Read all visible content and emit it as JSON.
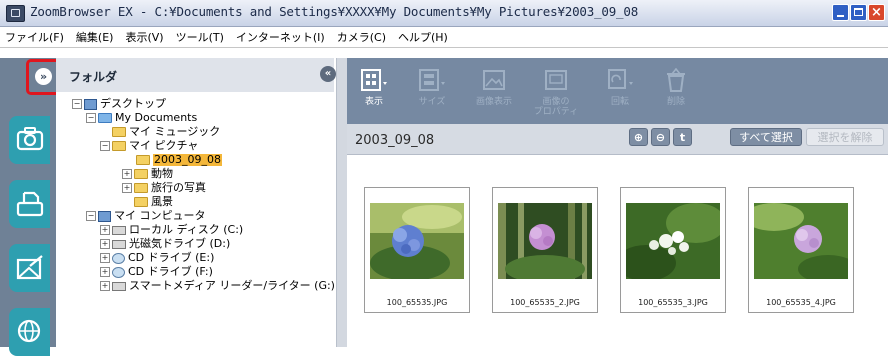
{
  "window": {
    "title": "ZoomBrowser EX  -  C:¥Documents and Settings¥XXXX¥My Documents¥My Pictures¥2003_09_08",
    "controls": [
      "minimize",
      "maximize",
      "close"
    ]
  },
  "menu": {
    "items": [
      "ファイル(F)",
      "編集(E)",
      "表示(V)",
      "ツール(T)",
      "インターネット(I)",
      "カメラ(C)",
      "ヘルプ(H)"
    ]
  },
  "sidebar": {
    "expand_icon": "double-chevron-right-icon",
    "highlight_color": "#e0161e",
    "tabs": [
      "camera-icon",
      "print-icon",
      "email-icon",
      "web-globe-icon"
    ]
  },
  "folder_panel": {
    "title": "フォルダ",
    "collapse_icon": "double-chevron-left-icon",
    "tree": [
      {
        "label": "デスクトップ",
        "icon": "desktop-icon"
      },
      {
        "label": "My Documents",
        "icon": "folder-icon"
      },
      {
        "label": "マイ ミュージック",
        "icon": "folder-icon"
      },
      {
        "label": "マイ ピクチャ",
        "icon": "folder-icon"
      },
      {
        "label": "2003_09_08",
        "icon": "folder-icon",
        "selected": true
      },
      {
        "label": "動物",
        "icon": "folder-icon"
      },
      {
        "label": "旅行の写真",
        "icon": "folder-icon"
      },
      {
        "label": "風景",
        "icon": "folder-icon"
      },
      {
        "label": "マイ コンピュータ",
        "icon": "computer-icon"
      },
      {
        "label": "ローカル ディスク (C:)",
        "icon": "drive-icon"
      },
      {
        "label": "光磁気ドライブ (D:)",
        "icon": "drive-icon"
      },
      {
        "label": "CD ドライブ (E:)",
        "icon": "cd-icon"
      },
      {
        "label": "CD ドライブ (F:)",
        "icon": "cd-icon"
      },
      {
        "label": "スマートメディア リーダー/ライター (G:)",
        "icon": "drive-icon"
      }
    ]
  },
  "toolbar": {
    "buttons": [
      {
        "label": "表示",
        "icon": "view-mode-icon",
        "active": true
      },
      {
        "label": "サイズ",
        "icon": "thumbnail-size-icon",
        "active": false
      },
      {
        "label": "画像表示",
        "icon": "image-view-icon",
        "active": false
      },
      {
        "label": "画像の\nプロパティ",
        "icon": "image-properties-icon",
        "active": false
      },
      {
        "label": "回転",
        "icon": "rotate-icon",
        "active": false
      },
      {
        "label": "削除",
        "icon": "delete-icon",
        "active": false
      }
    ]
  },
  "pathbar": {
    "path": "2003_09_08",
    "zoom_in_icon": "zoom-in-icon",
    "zoom_out_icon": "zoom-out-icon",
    "up_icon": "up-arrow-icon",
    "select_all": "すべて選択",
    "deselect": "選択を解除"
  },
  "thumbnails": [
    {
      "filename": "100_65535.JPG"
    },
    {
      "filename": "100_65535_2.JPG"
    },
    {
      "filename": "100_65535_3.JPG"
    },
    {
      "filename": "100_65535_4.JPG"
    }
  ]
}
